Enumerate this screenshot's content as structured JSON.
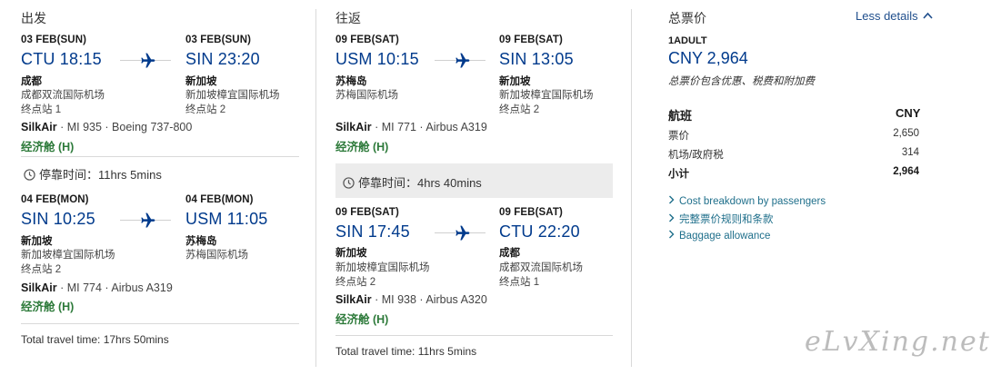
{
  "outbound": {
    "title": "出发",
    "seg1": {
      "dep_date": "03 FEB(SUN)",
      "dep_time": "CTU 18:15",
      "dep_city": "成都",
      "dep_airport": "成都双流国际机场",
      "dep_terminal": "终点站 1",
      "arr_date": "03 FEB(SUN)",
      "arr_time": "SIN 23:20",
      "arr_city": "新加坡",
      "arr_airport": "新加坡樟宜国际机场",
      "arr_terminal": "终点站 2",
      "airline": "SilkAir",
      "flight": "· MI 935 · Boeing 737-800",
      "cabin": "经济舱 (H)"
    },
    "layover": "停靠时间：11hrs 5mins",
    "seg2": {
      "dep_date": "04 FEB(MON)",
      "dep_time": "SIN 10:25",
      "dep_city": "新加坡",
      "dep_airport": "新加坡樟宜国际机场",
      "dep_terminal": "终点站 2",
      "arr_date": "04 FEB(MON)",
      "arr_time": "USM 11:05",
      "arr_city": "苏梅岛",
      "arr_airport": "苏梅国际机场",
      "arr_terminal": "",
      "airline": "SilkAir",
      "flight": "· MI 774 · Airbus A319",
      "cabin": "经济舱 (H)"
    },
    "total": "Total travel time: 17hrs 50mins"
  },
  "return": {
    "title": "往返",
    "seg1": {
      "dep_date": "09 FEB(SAT)",
      "dep_time": "USM 10:15",
      "dep_city": "苏梅岛",
      "dep_airport": "苏梅国际机场",
      "dep_terminal": "",
      "arr_date": "09 FEB(SAT)",
      "arr_time": "SIN 13:05",
      "arr_city": "新加坡",
      "arr_airport": "新加坡樟宜国际机场",
      "arr_terminal": "终点站 2",
      "airline": "SilkAir",
      "flight": "· MI 771 · Airbus A319",
      "cabin": "经济舱 (H)"
    },
    "layover": "停靠时间：4hrs 40mins",
    "seg2": {
      "dep_date": "09 FEB(SAT)",
      "dep_time": "SIN 17:45",
      "dep_city": "新加坡",
      "dep_airport": "新加坡樟宜国际机场",
      "dep_terminal": "终点站 2",
      "arr_date": "09 FEB(SAT)",
      "arr_time": "CTU 22:20",
      "arr_city": "成都",
      "arr_airport": "成都双流国际机场",
      "arr_terminal": "终点站 1",
      "airline": "SilkAir",
      "flight": "· MI 938 · Airbus A320",
      "cabin": "经济舱 (H)"
    },
    "total": "Total travel time: 11hrs 5mins"
  },
  "fare": {
    "title": "总票价",
    "less_details": "Less details",
    "passengers": "1ADULT",
    "total": "CNY 2,964",
    "note": "总票价包含优惠、税费和附加费",
    "table_header": "航班",
    "currency": "CNY",
    "rows": [
      {
        "label": "票价",
        "value": "2,650"
      },
      {
        "label": "机场/政府税",
        "value": "314"
      }
    ],
    "subtotal_label": "小计",
    "subtotal_value": "2,964",
    "links": [
      "Cost breakdown by passengers",
      "完整票价规则和条款",
      "Baggage allowance"
    ]
  },
  "watermark": "eLvXing.net",
  "colors": {
    "time_blue": "#003a8c",
    "cabin_green": "#2d7a3a",
    "link_teal": "#1f6f8b"
  }
}
